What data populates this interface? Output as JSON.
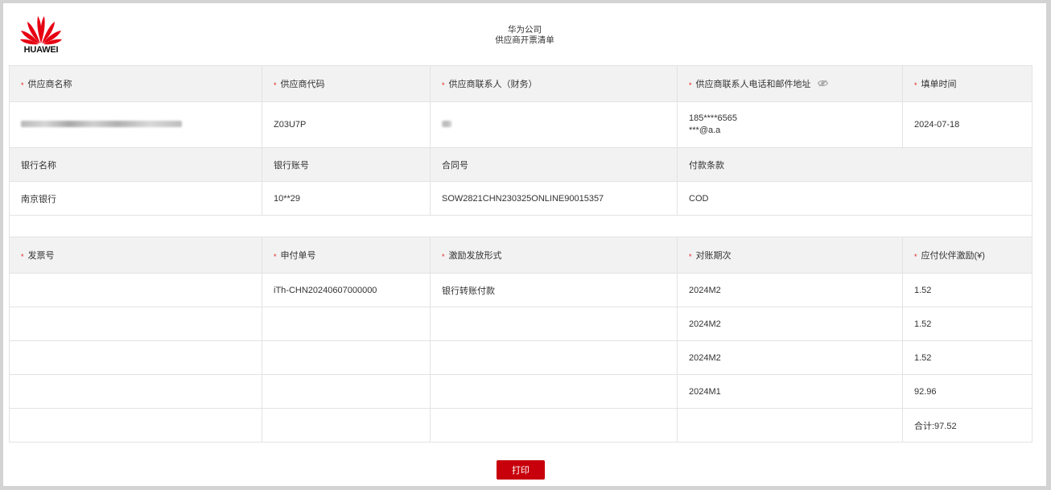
{
  "brand": {
    "logo_text": "HUAWEI"
  },
  "header": {
    "company": "华为公司",
    "doc_title": "供应商开票清单"
  },
  "section1": {
    "headers": [
      "供应商名称",
      "供应商代码",
      "供应商联系人（财务）",
      "供应商联系人电话和邮件地址",
      "填单时间"
    ],
    "values": {
      "supplier_code": "Z03U7P",
      "phone": "185****6565",
      "email": "***@a.a",
      "fill_date": "2024-07-18"
    }
  },
  "section2": {
    "headers": [
      "银行名称",
      "银行账号",
      "合同号",
      "付款条款"
    ],
    "values": [
      "南京银行",
      "10**29",
      "SOW2821CHN230325ONLINE90015357",
      "COD"
    ]
  },
  "section3": {
    "headers": [
      "发票号",
      "申付单号",
      "激励发放形式",
      "对账期次",
      "应付伙伴激励(¥)"
    ],
    "rows": [
      {
        "invoice": "",
        "apply_no": "iTh-CHN20240607000000",
        "form": "银行转账付款",
        "period": "2024M2",
        "amount": "1.52"
      },
      {
        "invoice": "",
        "apply_no": "",
        "form": "",
        "period": "2024M2",
        "amount": "1.52"
      },
      {
        "invoice": "",
        "apply_no": "",
        "form": "",
        "period": "2024M2",
        "amount": "1.52"
      },
      {
        "invoice": "",
        "apply_no": "",
        "form": "",
        "period": "2024M1",
        "amount": "92.96"
      }
    ],
    "total": "合计:97.52"
  },
  "actions": {
    "print_label": "打印"
  },
  "colors": {
    "brand_red": "#c7000b",
    "required_star": "#e02020",
    "header_bg": "#f2f2f2"
  }
}
